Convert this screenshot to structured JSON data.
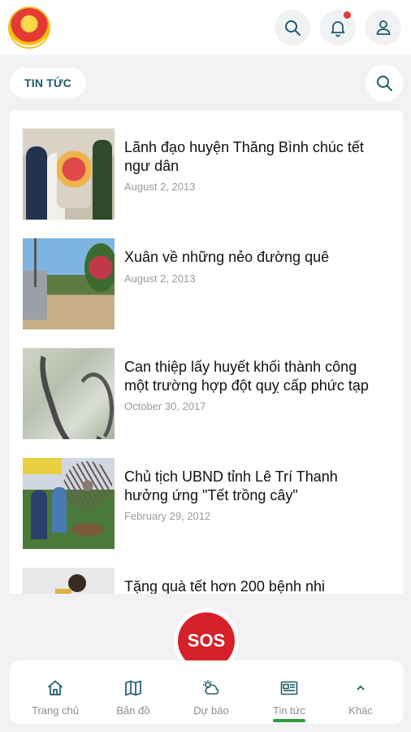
{
  "header": {
    "logo": "government-emblem",
    "icons": [
      "search-icon",
      "bell-icon",
      "user-icon"
    ],
    "notification_dot_color": "#e53935"
  },
  "category": {
    "label": "TIN TỨC",
    "search_icon": "search-icon"
  },
  "news": [
    {
      "title": "Lãnh đạo huyện Thăng Bình chúc tết ngư dân",
      "date": "August 2, 2013"
    },
    {
      "title": "Xuân về những nẻo đường quê",
      "date": "August 2, 2013"
    },
    {
      "title": "Can thiệp lấy huyết khối thành công một trường hợp đột quỵ cấp phức tạp",
      "date": "October 30, 2017"
    },
    {
      "title": "Chủ tịch UBND tỉnh Lê Trí Thanh hưởng ứng \"Tết trồng cây\"",
      "date": "February 29, 2012"
    },
    {
      "title": "Tặng quà tết hơn 200 bệnh nhi",
      "date": ""
    }
  ],
  "sos": {
    "label": "SOS",
    "color": "#d52029"
  },
  "bottom_nav": {
    "active_color": "#2e9e3a",
    "icon_color": "#1d5a6e",
    "items": [
      {
        "label": "Trang chủ",
        "icon": "home-icon"
      },
      {
        "label": "Bản đồ",
        "icon": "map-icon"
      },
      {
        "label": "Dự báo",
        "icon": "weather-icon"
      },
      {
        "label": "Tin tức",
        "icon": "newspaper-icon",
        "active": true
      },
      {
        "label": "Khác",
        "icon": "chevron-up-icon"
      }
    ]
  }
}
